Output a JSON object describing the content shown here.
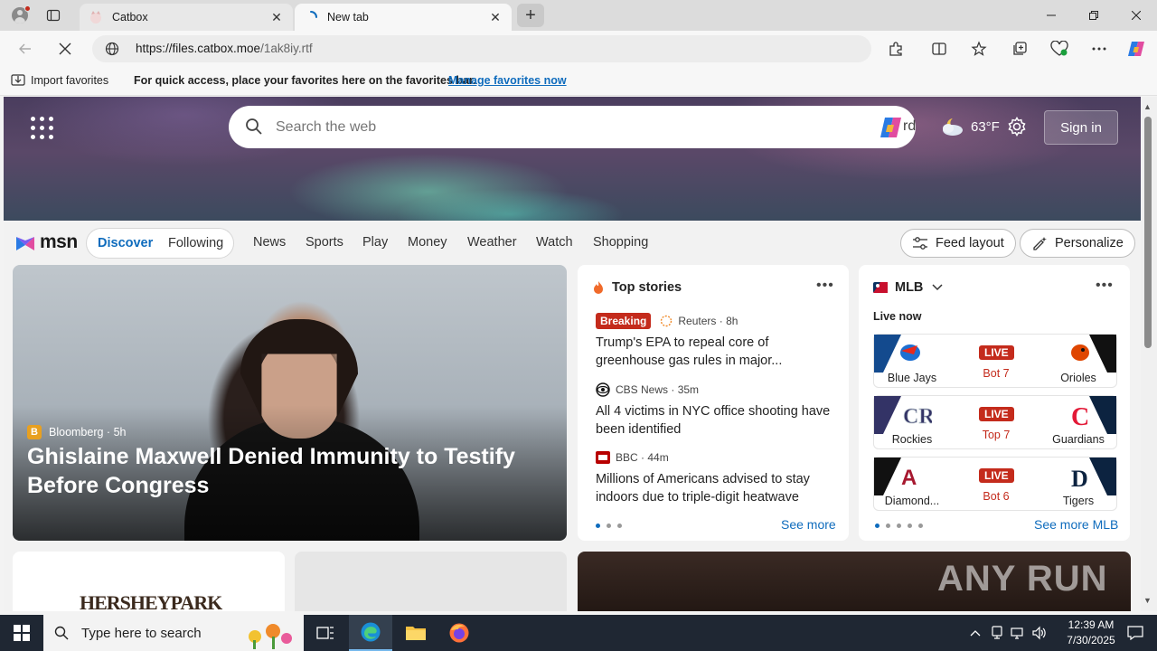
{
  "browser": {
    "tabs": [
      {
        "title": "Catbox",
        "active": false
      },
      {
        "title": "New tab",
        "active": true
      }
    ],
    "address": {
      "host": "https://files.catbox.moe",
      "path": "/1ak8iy.rtf"
    },
    "favorites_bar": {
      "import_label": "Import favorites",
      "hint": "For quick access, place your favorites here on the favorites bar.",
      "manage_link": "Manage favorites now"
    }
  },
  "hero": {
    "search_placeholder": "Search the web",
    "search_trailing_word": "rd",
    "weather_temp": "63°F",
    "sign_in": "Sign in"
  },
  "msn_nav": {
    "logo": "msn",
    "discover": "Discover",
    "following": "Following",
    "links": [
      "News",
      "Sports",
      "Play",
      "Money",
      "Weather",
      "Watch",
      "Shopping"
    ],
    "feed_layout": "Feed layout",
    "personalize": "Personalize"
  },
  "main_story": {
    "source": "Bloomberg",
    "age": "5h",
    "headline": "Ghislaine Maxwell Denied Immunity to Testify Before Congress"
  },
  "top_stories": {
    "title": "Top stories",
    "items": [
      {
        "badge": "Breaking",
        "source": "Reuters",
        "age": "8h",
        "title": "Trump's EPA to repeal core of greenhouse gas rules in major..."
      },
      {
        "badge": "",
        "source": "CBS News",
        "age": "35m",
        "title": "All 4 victims in NYC office shooting have been identified"
      },
      {
        "badge": "",
        "source": "BBC",
        "age": "44m",
        "title": "Millions of Americans advised to stay indoors due to triple-digit heatwave"
      }
    ],
    "see_more": "See more"
  },
  "mlb": {
    "title": "MLB",
    "live_now": "Live now",
    "games": [
      {
        "left": "Blue Jays",
        "right": "Orioles",
        "status": "LIVE",
        "inning": "Bot 7"
      },
      {
        "left": "Rockies",
        "right": "Guardians",
        "status": "LIVE",
        "inning": "Top 7"
      },
      {
        "left": "Diamond...",
        "right": "Tigers",
        "status": "LIVE",
        "inning": "Bot 6"
      }
    ],
    "see_more": "See more MLB"
  },
  "lower": {
    "hershey": "HERSHEYPARK",
    "watermark": "ANY RUN"
  },
  "taskbar": {
    "search_placeholder": "Type here to search",
    "time": "12:39 AM",
    "date": "7/30/2025"
  },
  "colors": {
    "accent": "#0f6cbd",
    "live_red": "#c42b1c",
    "taskbar": "#1f2733"
  }
}
